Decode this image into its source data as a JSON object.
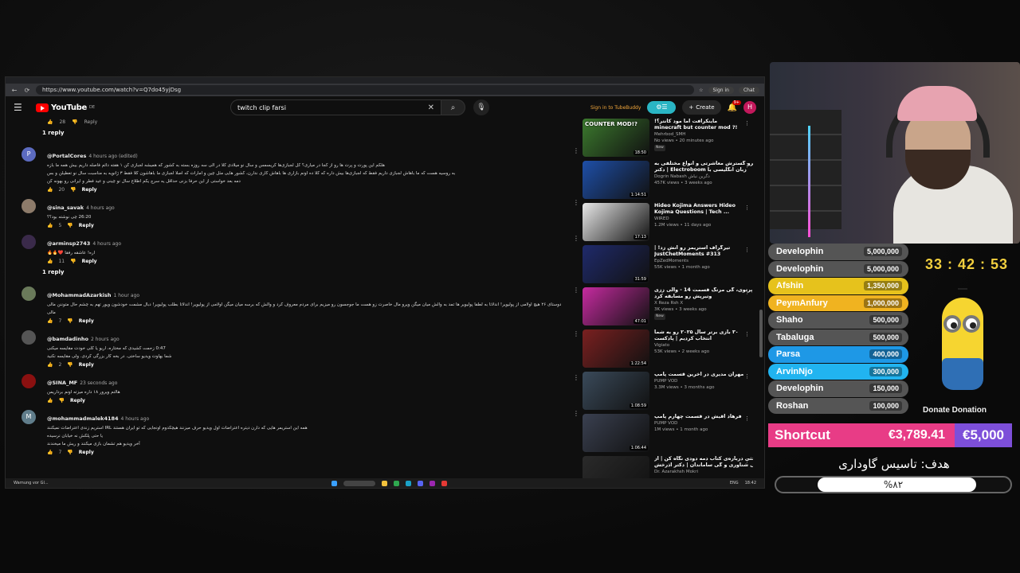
{
  "browser": {
    "url": "https://www.youtube.com/watch?v=Q7do45yjDsg",
    "signin_label": "Sign in",
    "chat_label": "Chat"
  },
  "youtube": {
    "logo_text": "YouTube",
    "logo_country": "DE",
    "search_value": "twitch clip farsi",
    "tubebuddy_label": "Sign in to TubeBuddy",
    "create_label": "Create",
    "notif_count": "9+",
    "avatar_letter": "H"
  },
  "comments": {
    "top_reply": {
      "likes": "28",
      "reply_label": "Reply"
    },
    "replies_label_1": "1 reply",
    "replies_label_2": "1 reply",
    "items": [
      {
        "author": "@PortalCores",
        "time": "4 hours ago (edited)",
        "avatar": "P",
        "avatar_color": "#5c6bc0",
        "lines": [
          "هلکم این پورت و پرت ها رو از کجا در میاری؟ کل لجبازی‌ها کریسمس و سال نو میلادی کلا در الی سه روزه بسته به کشور که همیشه لجبازی کن ۱ هفته دائم فاصله داریم بیش همه ما بازه",
          "به روسیه هست که ما باهاش لجبازی داریم فقط که لجبازی‌ها بیش داره که کلا ده اونم بازاری ها باهاش کاری ندارن، کشور هایی مثل چین و امارات که اصلا لجبازی ما باهاشون کلا فقط ۳ ژانویه به مناسبت سال نو تعطیلن و بس",
          "دمه بعد خواستی از این حرفا بزنی حداقل یه سرچ یکم اطلاع سال نو چینی و عید فطر و ایرانی رو بهونه کن"
        ],
        "likes": "20",
        "reply_label": "Reply"
      },
      {
        "author": "@sina_savak",
        "time": "4 hours ago",
        "avatar": "",
        "avatar_color": "#8d7b6a",
        "lines": [
          "26:20 چی نوشته بود؟؟"
        ],
        "link": "26:20",
        "likes": "5",
        "reply_label": "Reply"
      },
      {
        "author": "@arminsp2743",
        "time": "4 hours ago",
        "avatar": "",
        "avatar_color": "#3a2a4a",
        "lines": [
          "اره! عاشقه رفقا ❤️🔥🔥"
        ],
        "likes": "11",
        "reply_label": "Reply"
      },
      {
        "author": "@MohammadAzarkish",
        "time": "1 hour ago",
        "avatar": "",
        "avatar_color": "#6a7a5a",
        "lines": [
          "دوستای ۲۶ هیچ اولامی از پولیویر! اندلاتا به لطفا پولیویر ها تمد به والش میان میگن ویرو مال خاصرت زو هست ما جوجسون رو میزیم برای مردم معروف کرد و والش که برسه میان میگن اولامی از پولیویر! اندلاتا بطلب پولیویر! دبال مشمت خودشون ویور تهم به چشم حال متوننن مالی",
          "مالی"
        ],
        "likes": "7",
        "reply_label": "Reply"
      },
      {
        "author": "@bamdadinho",
        "time": "2 hours ago",
        "avatar": "",
        "avatar_color": "#555",
        "lines": [
          "0:47 زحمت کشیدی که مختاره، اریو یا کلی خودت مقایسه میکنی",
          "شما بهاوت ویدیو ساختی. در بخه کار بزرگی کردی. ولی مقایسه نکنید"
        ],
        "link": "0:47",
        "likes": "2",
        "reply_label": "Reply"
      },
      {
        "author": "@SINA_MF",
        "time": "23 seconds ago",
        "avatar": "",
        "avatar_color": "#8a1010",
        "lines": [
          "هالتم ویرور ۱۸ داره میزته اونم برداریمن"
        ],
        "likes": "",
        "reply_label": "Reply"
      },
      {
        "author": "@mohammadmalek4184",
        "time": "4 hours ago",
        "avatar": "M",
        "avatar_color": "#607d8b",
        "lines": [
          "همه این استریمر هایی که دارن دیتره اعتراضات اول ویدیو حرف میزنند هیچکدوم اونجایی که تو ایران هستند IRL استریم زندی اعتراضات نمیکنند",
          "یا حتی پلکش نه خیابان نرسیده",
          "آخر ویدیو هم تشمان بازی میکنند و ریش ما میخندند"
        ],
        "likes": "7",
        "reply_label": "Reply"
      }
    ]
  },
  "sidebar": {
    "videos": [
      {
        "title_lines": [
          "ماینکرافت اما مود کانتر؟!",
          "minecraft but counter mod ?!"
        ],
        "channel": "Mehrbod_SMH",
        "meta": "No views • 20 minutes ago",
        "badge": "New",
        "duration": "18:50",
        "thumb_text": "COUNTER MOD!?",
        "thumb_color": "#3c7a2e"
      },
      {
        "title_lines": [
          "مایکرو گسترش معاشرتی و انواع مختلفی به",
          "زبان انگلیسی با Electroboom | دکتر"
        ],
        "channel": "Dogrin Nabash دگرین نباش",
        "meta": "457K views • 3 weeks ago",
        "badge": "",
        "duration": "1:14:51",
        "thumb_text": "",
        "thumb_color": "#1e4fa8"
      },
      {
        "title_lines": [
          "Hideo Kojima Answers Hideo",
          "Kojima Questions | Tech ..."
        ],
        "channel": "WIRED",
        "meta": "1.2M views • 11 days ago",
        "badge": "",
        "duration": "17:13",
        "thumb_text": "",
        "thumb_color": "#e8e8e8"
      },
      {
        "title_lines": [
          "تیرگراف استریمر رو آنش زد! |",
          "JustChetMoments #313"
        ],
        "channel": "EpZedMoments",
        "meta": "55K views • 1 month ago",
        "badge": "",
        "duration": "31:59",
        "thumb_text": "",
        "thumb_color": "#1f2a6b"
      },
      {
        "title_lines": [
          "پرتوی، گی مرتگ قسمت 14 - والی ززی",
          "وتیرپش رو مسابقه کرد"
        ],
        "channel": "X Reza Rsh X",
        "meta": "3K views • 3 weeks ago",
        "badge": "New",
        "duration": "47:01",
        "thumb_text": "",
        "thumb_color": "#c62ba0"
      },
      {
        "title_lines": [
          "۳۰ بازی برتر سال ۲۰۲۵ رو به شما",
          "انتخاب کردیم | پادکست"
        ],
        "channel": "Vigiato",
        "meta": "53K views • 2 weeks ago",
        "badge": "",
        "duration": "1:22:54",
        "thumb_text": "",
        "thumb_color": "#7a2020"
      },
      {
        "title_lines": [
          "مهران مدیری در آخرین قسمت پامپ"
        ],
        "channel": "PUMP VOD",
        "meta": "3.3M views • 3 months ago",
        "badge": "",
        "duration": "1:08:59",
        "thumb_text": "",
        "thumb_color": "#3a4a5a"
      },
      {
        "title_lines": [
          "فرهاد آقیش در قسمت چهارم پامپ"
        ],
        "channel": "PUMP VOD",
        "meta": "1M views • 1 month ago",
        "badge": "",
        "duration": "1:06:44",
        "thumb_text": "",
        "thumb_color": "#3a4050"
      },
      {
        "title_lines": [
          "بحثی درباره‌ی کتاب دمه دودی نگاه کن | از",
          "جالی شناوری و گی ساماندان | دکتر آذرخش"
        ],
        "channel": "Dr. Azarakhsh Mokri",
        "meta": "",
        "badge": "",
        "duration": "",
        "thumb_text": "",
        "thumb_color": "#2a2a2a"
      }
    ]
  },
  "taskbar": {
    "warning": "Warnung vor Gl...",
    "lang": "ENG",
    "clock": "18:42"
  },
  "overlay": {
    "timer": "33 : 42 : 53",
    "leaderboard": [
      {
        "name": "Develophin",
        "amount": "5,000,000",
        "style": "grey"
      },
      {
        "name": "Develophin",
        "amount": "5,000,000",
        "style": "grey"
      },
      {
        "name": "Afshin",
        "amount": "1,350,000",
        "style": "gold"
      },
      {
        "name": "PeymAnfury",
        "amount": "1,000,000",
        "style": "orange"
      },
      {
        "name": "Shaho",
        "amount": "500,000",
        "style": "grey"
      },
      {
        "name": "Tabaluga",
        "amount": "500,000",
        "style": "grey"
      },
      {
        "name": "Parsa",
        "amount": "400,000",
        "style": "blue"
      },
      {
        "name": "ArvinNjo",
        "amount": "300,000",
        "style": "lblue"
      },
      {
        "name": "Develophin",
        "amount": "150,000",
        "style": "grey"
      },
      {
        "name": "Roshan",
        "amount": "100,000",
        "style": "grey"
      }
    ],
    "donation_label": "Donate Donation",
    "shortcut_name": "Shortcut",
    "shortcut_amount": "€3,789.41",
    "shortcut_goal": "€5,000",
    "goal_title": "هدف: تاسیس گاوداری",
    "goal_percent_text": "%۸۲",
    "goal_fraction": 0.82
  }
}
